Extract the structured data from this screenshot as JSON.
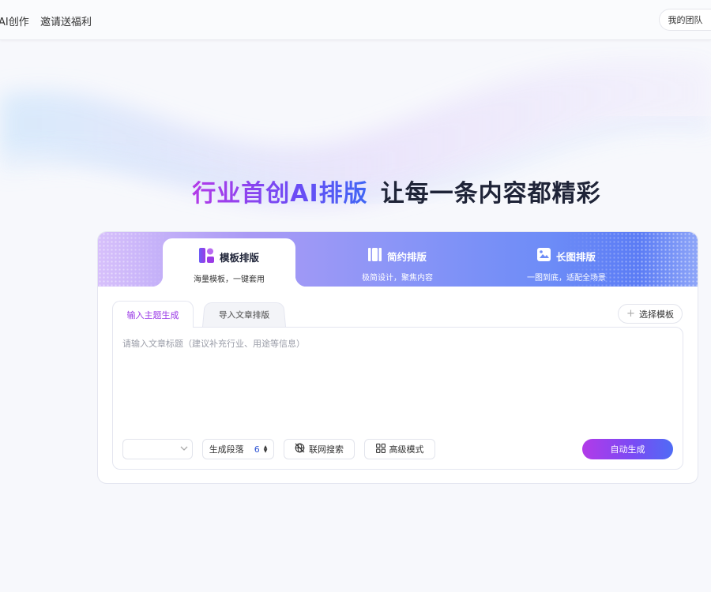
{
  "nav": {
    "items": [
      {
        "label": "AI创作"
      },
      {
        "label": "邀请送福利"
      }
    ],
    "team_button": "我的团队"
  },
  "hero": {
    "title_highlight": "行业首创AI排版",
    "title_rest": "让每一条内容都精彩"
  },
  "modes": [
    {
      "title": "模板排版",
      "subtitle": "海量模板，一键套用",
      "icon": "template-icon",
      "active": true
    },
    {
      "title": "简约排版",
      "subtitle": "极简设计，聚焦内容",
      "icon": "columns-icon",
      "active": false
    },
    {
      "title": "长图排版",
      "subtitle": "一图到底，适配全场景",
      "icon": "long-image-icon",
      "active": false
    }
  ],
  "input_tabs": [
    {
      "label": "输入主题生成",
      "active": true
    },
    {
      "label": "导入文章排版",
      "active": false
    }
  ],
  "select_template_label": "选择模板",
  "editor": {
    "placeholder": "请输入文章标题（建议补充行业、用途等信息）",
    "value": ""
  },
  "controls": {
    "type_select_value": "",
    "paragraph_label": "生成段落",
    "paragraph_count": "6",
    "web_search_label": "联网搜索",
    "advanced_label": "高级模式",
    "generate_label": "自动生成"
  },
  "colors": {
    "accent_purple": "#9a3ae6",
    "accent_blue": "#4f6cf5",
    "title_dark": "#1f2438"
  }
}
